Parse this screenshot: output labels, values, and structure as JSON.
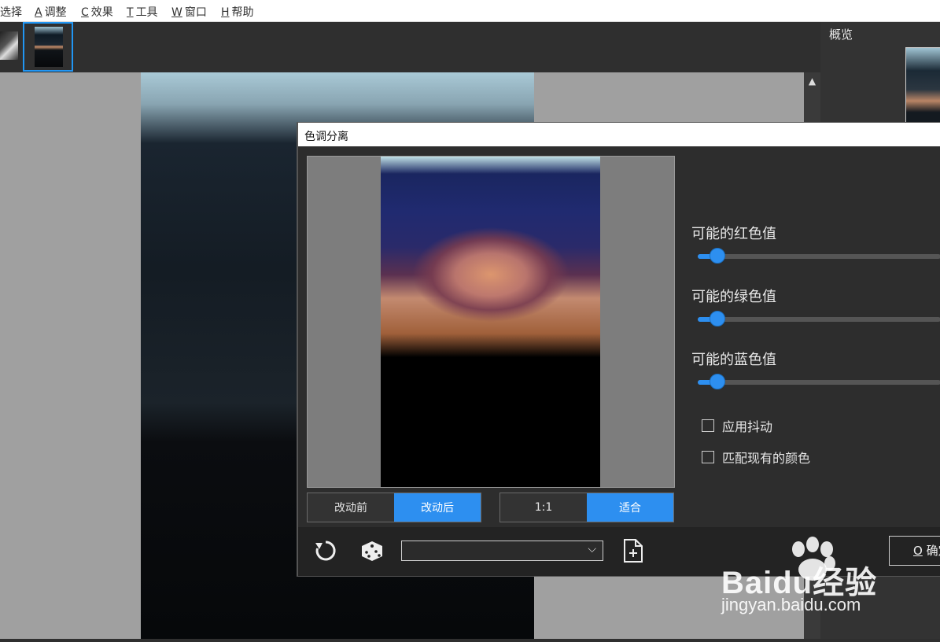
{
  "menu": {
    "items": [
      {
        "key": "",
        "label": "选择"
      },
      {
        "key": "A",
        "label": "调整"
      },
      {
        "key": "C",
        "label": "效果"
      },
      {
        "key": "T",
        "label": "工具"
      },
      {
        "key": "W",
        "label": "窗口"
      },
      {
        "key": "H",
        "label": "帮助"
      }
    ]
  },
  "overview": {
    "label": "概览"
  },
  "dialog": {
    "title": "色调分离",
    "compare": {
      "before": "改动前",
      "after": "改动后",
      "selected": "after"
    },
    "zoom": {
      "actual": "1:1",
      "fit": "适合",
      "selected": "fit"
    },
    "sliders": [
      {
        "label": "可能的红色值",
        "value_fraction": 0.08
      },
      {
        "label": "可能的绿色值",
        "value_fraction": 0.08
      },
      {
        "label": "可能的蓝色值",
        "value_fraction": 0.08
      }
    ],
    "checkboxes": [
      {
        "label": "应用抖动",
        "checked": false
      },
      {
        "label": "匹配现有的颜色",
        "checked": false
      }
    ],
    "preset": {
      "value": ""
    },
    "ok": {
      "key": "O",
      "label": "确定"
    }
  },
  "watermark": {
    "brand": "Baidu经验",
    "url": "jingyan.baidu.com"
  },
  "colors": {
    "accent": "#2d8ff0",
    "panel": "#2d2d2d",
    "canvas": "#a0a0a0"
  },
  "icons": [
    "reset-icon",
    "dice-icon",
    "chevron-down-icon",
    "new-file-icon",
    "scroll-up-icon"
  ]
}
